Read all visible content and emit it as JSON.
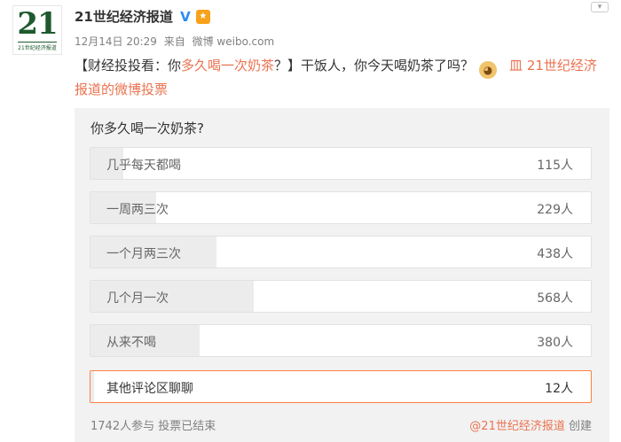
{
  "avatar": {
    "number": "21",
    "caption": "21世纪经济报道"
  },
  "user": {
    "name": "21世纪经济报道",
    "verified_icon": "V",
    "medal_icon": "medal-icon"
  },
  "meta": {
    "time": "12月14日 20:29",
    "source_prefix": "来自",
    "source": "微博 weibo.com"
  },
  "post": {
    "part1": "【财经投投看：你",
    "highlight": "多久喝一次奶茶",
    "part2": "？】干饭人，你今天喝奶茶了吗？",
    "vote_link": "21世纪经济报道的微博投票",
    "vote_link_icon": "皿"
  },
  "vote": {
    "title": "你多久喝一次奶茶?",
    "options": [
      {
        "label": "几乎每天都喝",
        "count": "115人",
        "votes": 115
      },
      {
        "label": "一周两三次",
        "count": "229人",
        "votes": 229
      },
      {
        "label": "一个月两三次",
        "count": "438人",
        "votes": 438
      },
      {
        "label": "几个月一次",
        "count": "568人",
        "votes": 568
      },
      {
        "label": "从来不喝",
        "count": "380人",
        "votes": 380
      },
      {
        "label": "其他评论区聊聊",
        "count": "12人",
        "votes": 12
      }
    ],
    "participants": "1742人参与",
    "status": "投票已结束",
    "creator": "@21世纪经济报道",
    "created_label": "创建"
  },
  "colors": {
    "accent": "#eb7350",
    "other_border": "#ff8140",
    "verified": "#2b8bf2"
  }
}
